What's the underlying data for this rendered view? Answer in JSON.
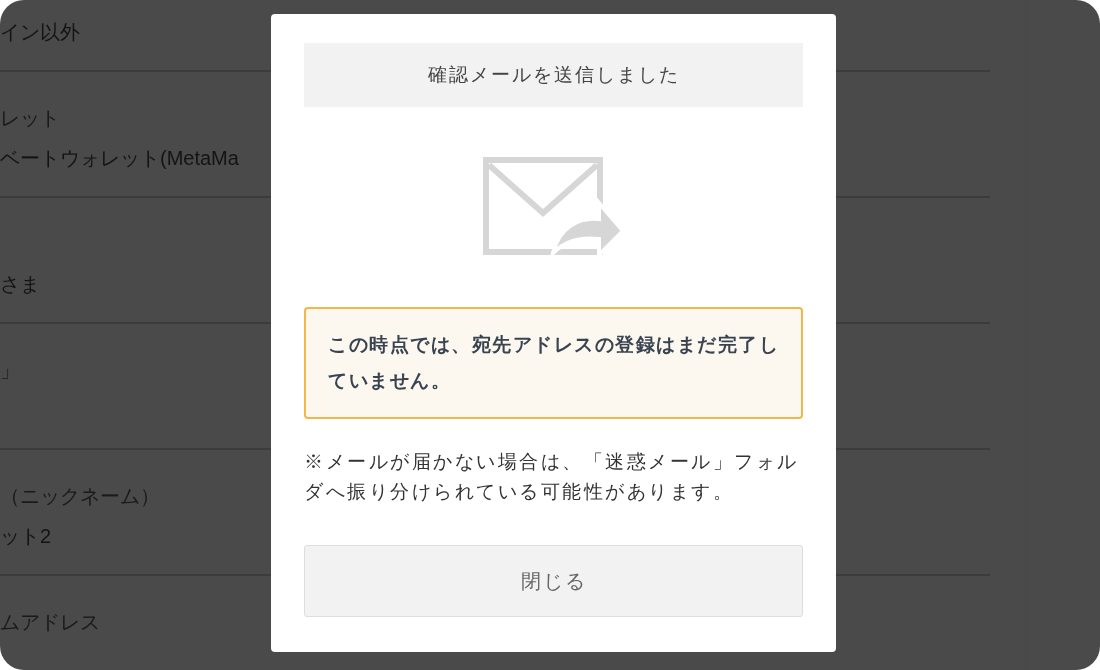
{
  "background": {
    "rows": [
      {
        "value": "イン以外"
      },
      {
        "label": "レット",
        "value": "ベートウォレット(MetaMa"
      },
      {
        "value": "さま"
      },
      {
        "label": "」"
      },
      {
        "label": "（ニックネーム）",
        "value": "ット2"
      },
      {
        "label": "ムアドレス"
      }
    ]
  },
  "dialog": {
    "title": "確認メールを送信しました",
    "warning": "この時点では、宛先アドレスの登録はまだ完了していません。",
    "note": "※メールが届かない場合は、「迷惑メール」フォルダへ振り分けられている可能性があります。",
    "close_button": "閉じる"
  }
}
